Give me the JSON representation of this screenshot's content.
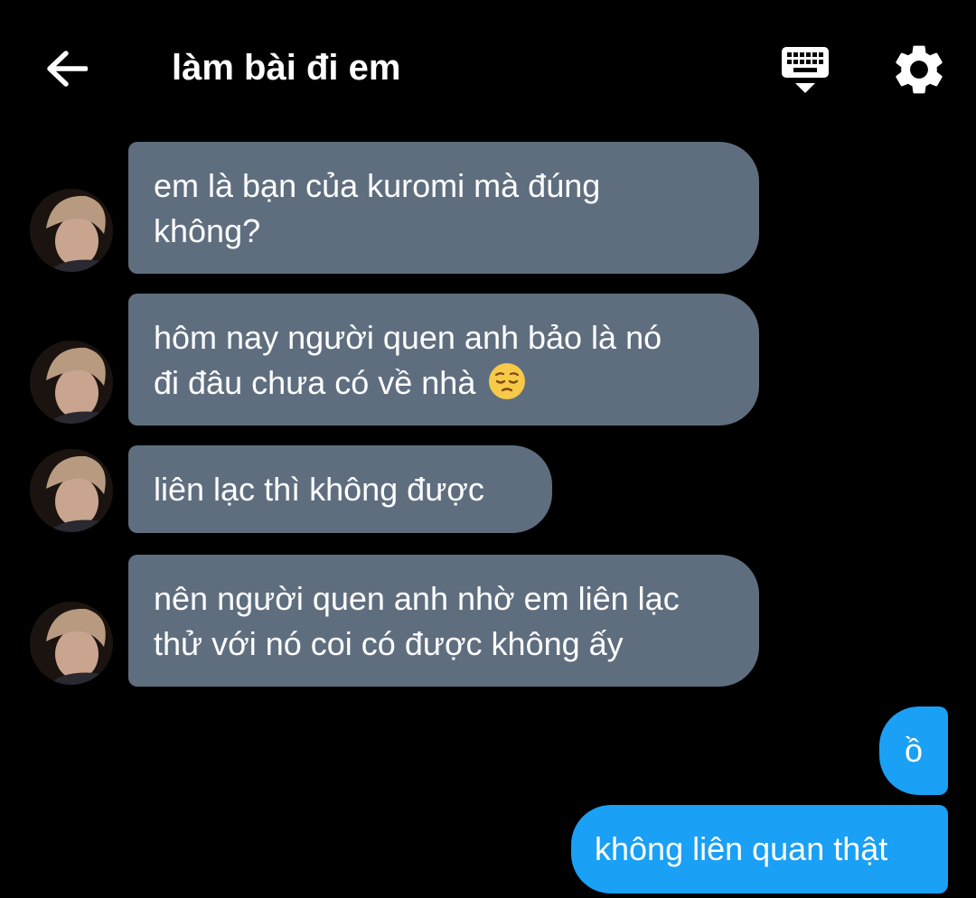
{
  "header": {
    "title": "làm bài đi em"
  },
  "messages": [
    {
      "direction": "incoming",
      "lines": [
        "em là bạn của kuromi mà đúng",
        "không?"
      ]
    },
    {
      "direction": "incoming",
      "lines": [
        "hôm nay người quen anh bảo là nó",
        "đi đâu chưa có về nhà"
      ],
      "emoji": "pensive-face"
    },
    {
      "direction": "incoming",
      "lines": [
        "liên lạc thì không được"
      ]
    },
    {
      "direction": "incoming",
      "lines": [
        "nên người quen anh nhờ em liên lạc",
        "thử với nó coi có được không ấy"
      ]
    },
    {
      "direction": "outgoing",
      "lines": [
        "ồ"
      ]
    },
    {
      "direction": "outgoing",
      "lines": [
        "không liên quan thật"
      ]
    }
  ],
  "colors": {
    "background": "#000000",
    "incoming_bubble": "#5f6e7f",
    "outgoing_bubble": "#1aa0f5",
    "text": "#ffffff"
  },
  "icons": [
    "back-arrow-icon",
    "keyboard-icon",
    "gear-icon",
    "pensive-face-emoji"
  ]
}
